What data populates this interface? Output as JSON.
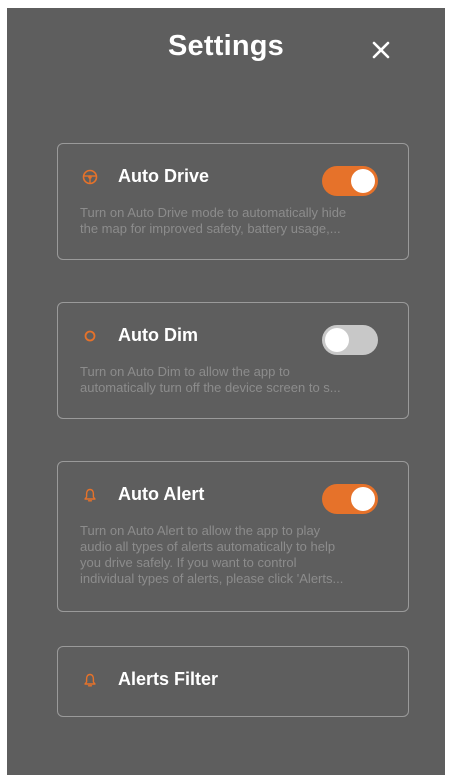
{
  "header": {
    "title": "Settings",
    "close_icon": "close-icon"
  },
  "colors": {
    "background": "#5e5e5e",
    "accent": "#e6722a",
    "toggle_off": "#c8c8c8",
    "card_border": "#9a9a9a",
    "description_text": "#8c8c8c"
  },
  "settings": {
    "auto_drive": {
      "icon": "steering-wheel-icon",
      "label": "Auto Drive",
      "description": "Turn on Auto Drive mode to automatically hide\nthe map for improved safety, battery usage,...",
      "enabled": true
    },
    "auto_dim": {
      "icon": "brightness-icon",
      "label": "Auto Dim",
      "description": "Turn on Auto Dim to allow the app to\nautomatically turn off the device screen to s...",
      "enabled": false
    },
    "auto_alert": {
      "icon": "bell-icon",
      "label": "Auto Alert",
      "description": "Turn on Auto Alert to allow the app to play\naudio all types of alerts automatically to help\nyou drive safely. If you want to control\nindividual types of alerts, please click 'Alerts...",
      "enabled": true
    },
    "alerts_filter": {
      "icon": "bell-icon",
      "label": "Alerts Filter"
    }
  }
}
